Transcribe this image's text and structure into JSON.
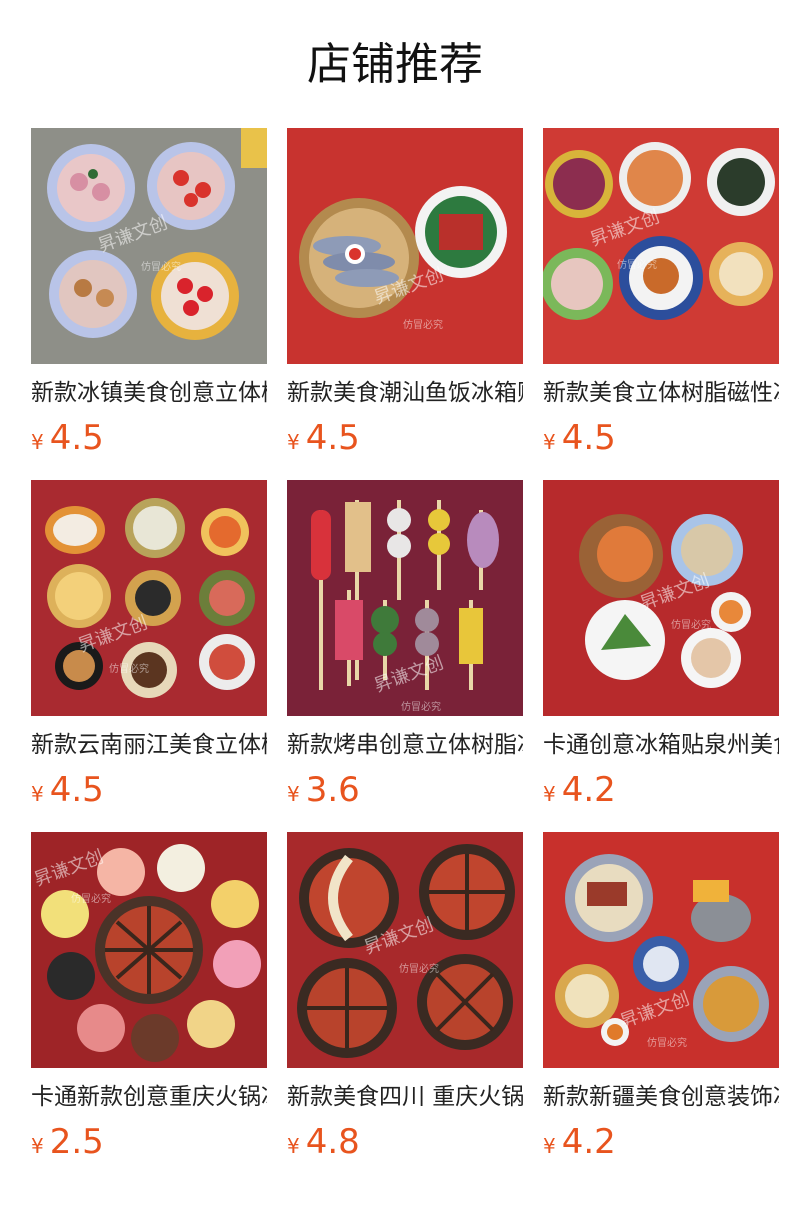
{
  "header": {
    "title": "店铺推荐"
  },
  "colors": {
    "accent": "#e8541e",
    "text": "#222222"
  },
  "watermark": {
    "line1": "昇谦文创",
    "line2": "仿冒必究"
  },
  "products": [
    {
      "name": "新款冰镇美食创意立体树脂磁性冰箱贴",
      "currency": "¥",
      "price": "4.5",
      "bg": "#8f9189"
    },
    {
      "name": "新款美食潮汕鱼饭冰箱贴",
      "currency": "¥",
      "price": "4.5",
      "bg": "#c8332f"
    },
    {
      "name": "新款美食立体树脂磁性冰箱贴",
      "currency": "¥",
      "price": "4.5",
      "bg": "#cf3a34"
    },
    {
      "name": "新款云南丽江美食立体树脂冰箱贴",
      "currency": "¥",
      "price": "4.5",
      "bg": "#a92a30"
    },
    {
      "name": "新款烤串创意立体树脂冰箱贴",
      "currency": "¥",
      "price": "3.6",
      "bg": "#7a2238"
    },
    {
      "name": "卡通创意冰箱贴泉州美食",
      "currency": "¥",
      "price": "4.2",
      "bg": "#b72a2c"
    },
    {
      "name": "卡通新款创意重庆火锅冰箱贴",
      "currency": "¥",
      "price": "2.5",
      "bg": "#9e2427"
    },
    {
      "name": "新款美食四川 重庆火锅冰箱贴",
      "currency": "¥",
      "price": "4.8",
      "bg": "#a8292b"
    },
    {
      "name": "新款新疆美食创意装饰冰箱贴",
      "currency": "¥",
      "price": "4.2",
      "bg": "#c8302c"
    }
  ]
}
